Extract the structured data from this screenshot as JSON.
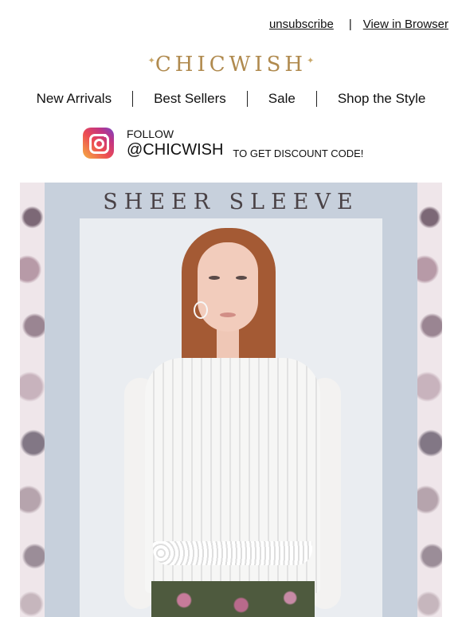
{
  "header": {
    "unsubscribe_label": "unsubscribe",
    "separator": "|",
    "view_in_browser_label": "View in Browser"
  },
  "logo": {
    "text": "CHICWISH",
    "color": "#b08a4e"
  },
  "nav": {
    "items": [
      {
        "label": "New Arrivals"
      },
      {
        "label": "Best Sellers"
      },
      {
        "label": "Sale"
      },
      {
        "label": "Shop the Style"
      }
    ]
  },
  "instagram": {
    "icon": "instagram-icon",
    "follow_label": "FOLLOW",
    "handle": "@CHICWISH",
    "cta": "TO GET DISCOUNT CODE!"
  },
  "hero": {
    "title": "SHEER SLEEVE",
    "panel_color": "#c7d0dc",
    "image": "model-white-lace-blouse"
  }
}
